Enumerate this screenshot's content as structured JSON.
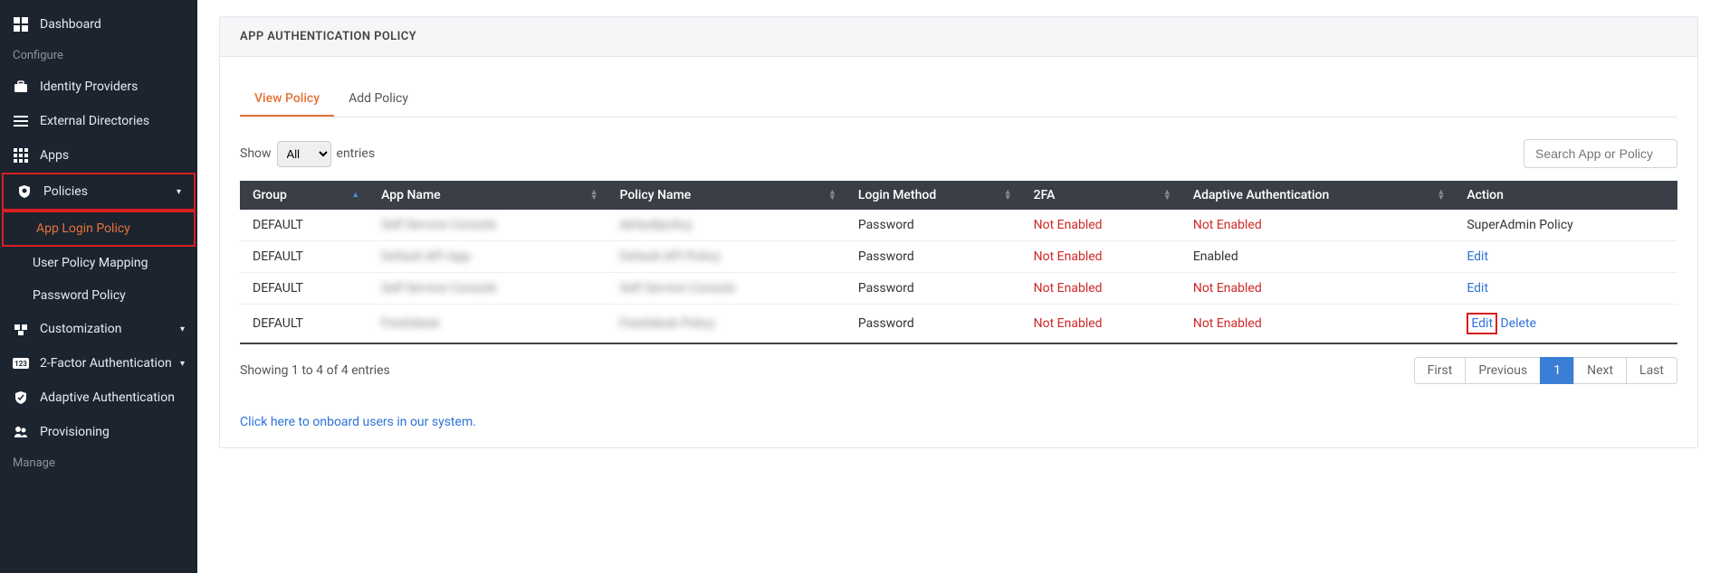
{
  "sidebar": {
    "dashboard": "Dashboard",
    "configure_label": "Configure",
    "identity_providers": "Identity Providers",
    "external_directories": "External Directories",
    "apps": "Apps",
    "policies": "Policies",
    "policies_children": {
      "app_login_policy": "App Login Policy",
      "user_policy_mapping": "User Policy Mapping",
      "password_policy": "Password Policy"
    },
    "customization": "Customization",
    "two_factor": "2-Factor Authentication",
    "adaptive_auth": "Adaptive Authentication",
    "provisioning": "Provisioning",
    "manage_label": "Manage"
  },
  "panel": {
    "title": "APP AUTHENTICATION POLICY",
    "tabs": {
      "view": "View Policy",
      "add": "Add Policy"
    },
    "show_label": "Show",
    "entries_label": "entries",
    "entries_select": "All",
    "search_placeholder": "Search App or Policy",
    "columns": {
      "group": "Group",
      "app_name": "App Name",
      "policy_name": "Policy Name",
      "login_method": "Login Method",
      "twofa": "2FA",
      "adaptive": "Adaptive Authentication",
      "action": "Action"
    },
    "rows": [
      {
        "group": "DEFAULT",
        "app_name": "Self Service Console",
        "policy_name": "defaultpolicy",
        "login_method": "Password",
        "twofa": "Not Enabled",
        "adaptive": "Not Enabled",
        "action_text": "SuperAdmin Policy",
        "action_type": "text"
      },
      {
        "group": "DEFAULT",
        "app_name": "Default API App",
        "policy_name": "Default API Policy",
        "login_method": "Password",
        "twofa": "Not Enabled",
        "adaptive": "Enabled",
        "action_text": "Edit",
        "action_type": "link"
      },
      {
        "group": "DEFAULT",
        "app_name": "Self Service Console",
        "policy_name": "Self Service Console",
        "login_method": "Password",
        "twofa": "Not Enabled",
        "adaptive": "Not Enabled",
        "action_text": "Edit",
        "action_type": "link"
      },
      {
        "group": "DEFAULT",
        "app_name": "Freshdesk",
        "policy_name": "Freshdesk Policy",
        "login_method": "Password",
        "twofa": "Not Enabled",
        "adaptive": "Not Enabled",
        "action_text": "Edit",
        "action_delete": "Delete",
        "action_type": "link-highlighted"
      }
    ],
    "footer_info": "Showing 1 to 4 of 4 entries",
    "pagination": {
      "first": "First",
      "previous": "Previous",
      "page": "1",
      "next": "Next",
      "last": "Last"
    },
    "onboard_link": "Click here to onboard users in our system."
  }
}
